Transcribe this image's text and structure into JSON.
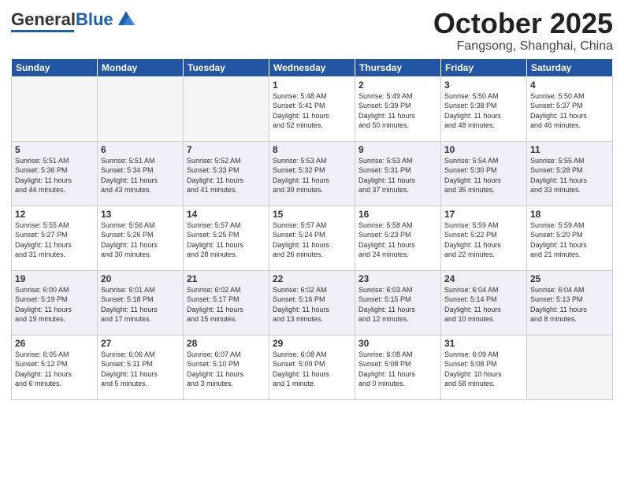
{
  "logo": {
    "text1": "General",
    "text2": "Blue"
  },
  "title": "October 2025",
  "location": "Fangsong, Shanghai, China",
  "weekdays": [
    "Sunday",
    "Monday",
    "Tuesday",
    "Wednesday",
    "Thursday",
    "Friday",
    "Saturday"
  ],
  "weeks": [
    [
      {
        "day": "",
        "info": ""
      },
      {
        "day": "",
        "info": ""
      },
      {
        "day": "",
        "info": ""
      },
      {
        "day": "1",
        "info": "Sunrise: 5:48 AM\nSunset: 5:41 PM\nDaylight: 11 hours\nand 52 minutes."
      },
      {
        "day": "2",
        "info": "Sunrise: 5:49 AM\nSunset: 5:39 PM\nDaylight: 11 hours\nand 50 minutes."
      },
      {
        "day": "3",
        "info": "Sunrise: 5:50 AM\nSunset: 5:38 PM\nDaylight: 11 hours\nand 48 minutes."
      },
      {
        "day": "4",
        "info": "Sunrise: 5:50 AM\nSunset: 5:37 PM\nDaylight: 11 hours\nand 46 minutes."
      }
    ],
    [
      {
        "day": "5",
        "info": "Sunrise: 5:51 AM\nSunset: 5:36 PM\nDaylight: 11 hours\nand 44 minutes."
      },
      {
        "day": "6",
        "info": "Sunrise: 5:51 AM\nSunset: 5:34 PM\nDaylight: 11 hours\nand 43 minutes."
      },
      {
        "day": "7",
        "info": "Sunrise: 5:52 AM\nSunset: 5:33 PM\nDaylight: 11 hours\nand 41 minutes."
      },
      {
        "day": "8",
        "info": "Sunrise: 5:53 AM\nSunset: 5:32 PM\nDaylight: 11 hours\nand 39 minutes."
      },
      {
        "day": "9",
        "info": "Sunrise: 5:53 AM\nSunset: 5:31 PM\nDaylight: 11 hours\nand 37 minutes."
      },
      {
        "day": "10",
        "info": "Sunrise: 5:54 AM\nSunset: 5:30 PM\nDaylight: 11 hours\nand 35 minutes."
      },
      {
        "day": "11",
        "info": "Sunrise: 5:55 AM\nSunset: 5:28 PM\nDaylight: 11 hours\nand 33 minutes."
      }
    ],
    [
      {
        "day": "12",
        "info": "Sunrise: 5:55 AM\nSunset: 5:27 PM\nDaylight: 11 hours\nand 31 minutes."
      },
      {
        "day": "13",
        "info": "Sunrise: 5:56 AM\nSunset: 5:26 PM\nDaylight: 11 hours\nand 30 minutes."
      },
      {
        "day": "14",
        "info": "Sunrise: 5:57 AM\nSunset: 5:25 PM\nDaylight: 11 hours\nand 28 minutes."
      },
      {
        "day": "15",
        "info": "Sunrise: 5:57 AM\nSunset: 5:24 PM\nDaylight: 11 hours\nand 26 minutes."
      },
      {
        "day": "16",
        "info": "Sunrise: 5:58 AM\nSunset: 5:23 PM\nDaylight: 11 hours\nand 24 minutes."
      },
      {
        "day": "17",
        "info": "Sunrise: 5:59 AM\nSunset: 5:22 PM\nDaylight: 11 hours\nand 22 minutes."
      },
      {
        "day": "18",
        "info": "Sunrise: 5:59 AM\nSunset: 5:20 PM\nDaylight: 11 hours\nand 21 minutes."
      }
    ],
    [
      {
        "day": "19",
        "info": "Sunrise: 6:00 AM\nSunset: 5:19 PM\nDaylight: 11 hours\nand 19 minutes."
      },
      {
        "day": "20",
        "info": "Sunrise: 6:01 AM\nSunset: 5:18 PM\nDaylight: 11 hours\nand 17 minutes."
      },
      {
        "day": "21",
        "info": "Sunrise: 6:02 AM\nSunset: 5:17 PM\nDaylight: 11 hours\nand 15 minutes."
      },
      {
        "day": "22",
        "info": "Sunrise: 6:02 AM\nSunset: 5:16 PM\nDaylight: 11 hours\nand 13 minutes."
      },
      {
        "day": "23",
        "info": "Sunrise: 6:03 AM\nSunset: 5:15 PM\nDaylight: 11 hours\nand 12 minutes."
      },
      {
        "day": "24",
        "info": "Sunrise: 6:04 AM\nSunset: 5:14 PM\nDaylight: 11 hours\nand 10 minutes."
      },
      {
        "day": "25",
        "info": "Sunrise: 6:04 AM\nSunset: 5:13 PM\nDaylight: 11 hours\nand 8 minutes."
      }
    ],
    [
      {
        "day": "26",
        "info": "Sunrise: 6:05 AM\nSunset: 5:12 PM\nDaylight: 11 hours\nand 6 minutes."
      },
      {
        "day": "27",
        "info": "Sunrise: 6:06 AM\nSunset: 5:11 PM\nDaylight: 11 hours\nand 5 minutes."
      },
      {
        "day": "28",
        "info": "Sunrise: 6:07 AM\nSunset: 5:10 PM\nDaylight: 11 hours\nand 3 minutes."
      },
      {
        "day": "29",
        "info": "Sunrise: 6:08 AM\nSunset: 5:09 PM\nDaylight: 11 hours\nand 1 minute."
      },
      {
        "day": "30",
        "info": "Sunrise: 6:08 AM\nSunset: 5:08 PM\nDaylight: 11 hours\nand 0 minutes."
      },
      {
        "day": "31",
        "info": "Sunrise: 6:09 AM\nSunset: 5:08 PM\nDaylight: 10 hours\nand 58 minutes."
      },
      {
        "day": "",
        "info": ""
      }
    ]
  ]
}
